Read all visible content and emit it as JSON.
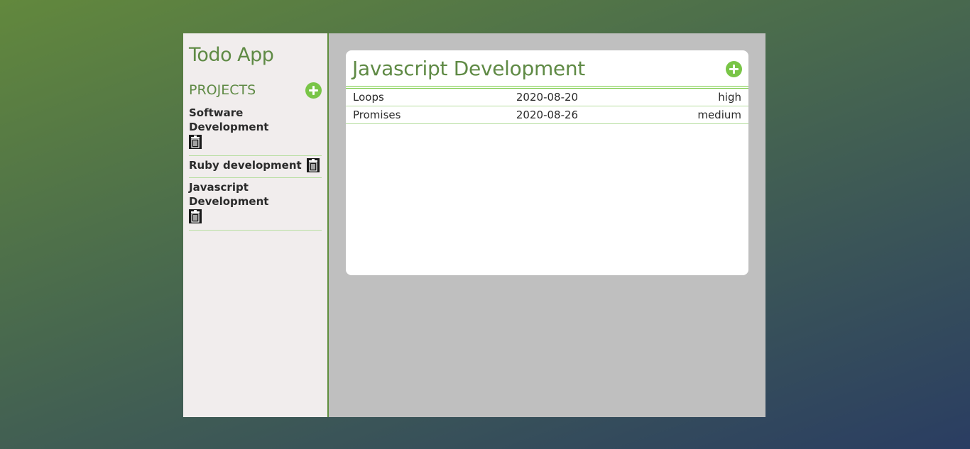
{
  "app": {
    "title": "Todo App"
  },
  "sidebar": {
    "section_label": "PROJECTS",
    "projects": [
      {
        "name": "Software Development"
      },
      {
        "name": "Ruby development"
      },
      {
        "name": "Javascript Development"
      }
    ]
  },
  "main": {
    "project_title": "Javascript Development",
    "todos": [
      {
        "title": "Loops",
        "date": "2020-08-20",
        "priority": "high"
      },
      {
        "title": "Promises",
        "date": "2020-08-26",
        "priority": "medium"
      }
    ]
  },
  "colors": {
    "accent": "#5f8a45",
    "add_button": "#79c547",
    "divider": "#b7dea0",
    "sidebar_bg": "#f1eded",
    "main_bg": "#bfbfbf"
  },
  "icons": {
    "add": "plus-circle-icon",
    "delete": "trash-icon"
  }
}
